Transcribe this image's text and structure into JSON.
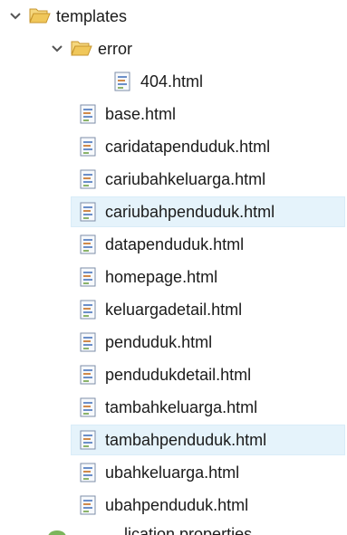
{
  "tree": {
    "root_folder": {
      "label": "templates",
      "expanded": true
    },
    "sub_folder": {
      "label": "error",
      "expanded": true
    },
    "error_files": [
      "404.html"
    ],
    "files": [
      {
        "label": "base.html",
        "selected": false
      },
      {
        "label": "caridatapenduduk.html",
        "selected": false
      },
      {
        "label": "cariubahkeluarga.html",
        "selected": false
      },
      {
        "label": "cariubahpenduduk.html",
        "selected": true
      },
      {
        "label": "datapenduduk.html",
        "selected": false
      },
      {
        "label": "homepage.html",
        "selected": false
      },
      {
        "label": "keluargadetail.html",
        "selected": false
      },
      {
        "label": "penduduk.html",
        "selected": false
      },
      {
        "label": "pendudukdetail.html",
        "selected": false
      },
      {
        "label": "tambahkeluarga.html",
        "selected": false
      },
      {
        "label": "tambahpenduduk.html",
        "selected": true
      },
      {
        "label": "ubahkeluarga.html",
        "selected": false
      },
      {
        "label": "ubahpenduduk.html",
        "selected": false
      }
    ],
    "partial_next": {
      "label": "...lication.properties"
    }
  },
  "icons": {
    "chevron": "chevron-down-icon",
    "folder": "open-folder-icon",
    "file": "html-file-icon"
  },
  "colors": {
    "selection_bg": "#e5f3fb",
    "folder_yellow": "#e8b84a",
    "file_blue": "#6b8fc9"
  }
}
